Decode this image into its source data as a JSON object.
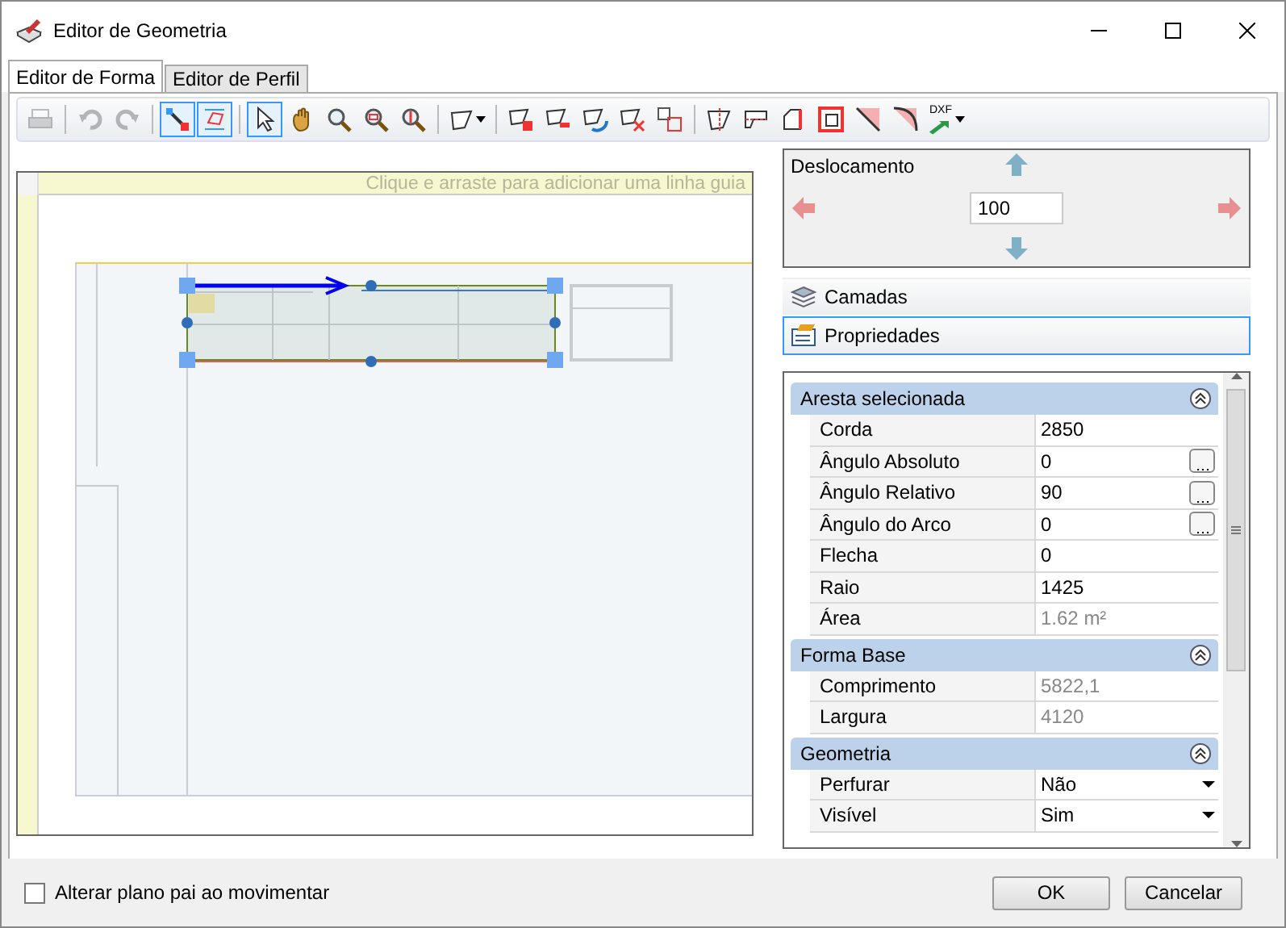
{
  "window": {
    "title": "Editor de Geometria"
  },
  "tabs": [
    {
      "label": "Editor de Forma",
      "selected": true
    },
    {
      "label": "Editor de Perfil",
      "selected": false
    }
  ],
  "toolbar": [
    {
      "kind": "button",
      "disabled": true,
      "on": false
    },
    {
      "kind": "separator"
    },
    {
      "kind": "button",
      "disabled": true,
      "on": false
    },
    {
      "kind": "button",
      "disabled": true,
      "on": false
    },
    {
      "kind": "separator"
    },
    {
      "kind": "button",
      "disabled": false,
      "on": true
    },
    {
      "kind": "button",
      "disabled": false,
      "on": true
    },
    {
      "kind": "separator"
    },
    {
      "kind": "button",
      "disabled": false,
      "on": true
    },
    {
      "kind": "button",
      "disabled": false,
      "on": false
    },
    {
      "kind": "button",
      "disabled": false,
      "on": false
    },
    {
      "kind": "button",
      "disabled": false,
      "on": false
    },
    {
      "kind": "button",
      "disabled": false,
      "on": false
    },
    {
      "kind": "separator"
    },
    {
      "kind": "dropdown",
      "disabled": false,
      "on": false
    },
    {
      "kind": "separator"
    },
    {
      "kind": "button",
      "disabled": false,
      "on": false
    },
    {
      "kind": "button",
      "disabled": false,
      "on": false
    },
    {
      "kind": "button",
      "disabled": false,
      "on": false
    },
    {
      "kind": "button",
      "disabled": false,
      "on": false
    },
    {
      "kind": "button",
      "disabled": false,
      "on": false
    },
    {
      "kind": "separator"
    },
    {
      "kind": "button",
      "disabled": false,
      "on": false
    },
    {
      "kind": "button",
      "disabled": false,
      "on": false
    },
    {
      "kind": "button",
      "disabled": false,
      "on": false
    },
    {
      "kind": "button",
      "disabled": false,
      "on": false
    },
    {
      "kind": "button",
      "disabled": false,
      "on": false
    },
    {
      "kind": "button",
      "disabled": false,
      "on": false
    },
    {
      "kind": "dropdown",
      "disabled": false,
      "on": false,
      "label": "DXF"
    }
  ],
  "canvas": {
    "ruler_hint": "Clique e arraste para adicionar uma linha guia"
  },
  "offset_panel": {
    "title": "Deslocamento",
    "value": "100"
  },
  "panels": [
    {
      "label": "Camadas",
      "selected": false
    },
    {
      "label": "Propriedades",
      "selected": true
    }
  ],
  "property_groups": [
    {
      "title": "Aresta selecionada",
      "expanded": true,
      "rows": [
        {
          "label": "Corda",
          "value": "2850",
          "kind": "text",
          "readonly": false
        },
        {
          "label": "Ângulo Absoluto",
          "value": "0",
          "kind": "ellipsis",
          "readonly": false
        },
        {
          "label": "Ângulo Relativo",
          "value": "90",
          "kind": "ellipsis",
          "readonly": false
        },
        {
          "label": "Ângulo do Arco",
          "value": "0",
          "kind": "ellipsis",
          "readonly": false
        },
        {
          "label": "Flecha",
          "value": "0",
          "kind": "text",
          "readonly": false
        },
        {
          "label": "Raio",
          "value": "1425",
          "kind": "text",
          "readonly": false
        },
        {
          "label": "Área",
          "value": "1.62 m²",
          "kind": "text",
          "readonly": true
        }
      ]
    },
    {
      "title": "Forma Base",
      "expanded": true,
      "rows": [
        {
          "label": "Comprimento",
          "value": "5822,1",
          "kind": "text",
          "readonly": true
        },
        {
          "label": "Largura",
          "value": "4120",
          "kind": "text",
          "readonly": true
        }
      ]
    },
    {
      "title": "Geometria",
      "expanded": true,
      "rows": [
        {
          "label": "Perfurar",
          "value": "Não",
          "kind": "dropdown",
          "readonly": false
        },
        {
          "label": "Visível",
          "value": "Sim",
          "kind": "dropdown",
          "readonly": false
        }
      ]
    }
  ],
  "footer": {
    "checkbox": {
      "label": "Alterar plano pai ao movimentar",
      "checked": false
    },
    "buttons": [
      "OK",
      "Cancelar"
    ]
  }
}
